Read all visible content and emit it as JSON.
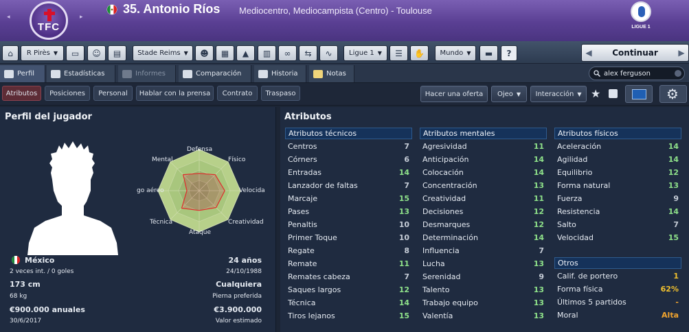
{
  "header": {
    "title": "35. Antonio Ríos",
    "subtitle": "Mediocentro, Mediocampista (Centro) - Toulouse",
    "club_badge": "TFC",
    "league_logo": "LIGUE 1",
    "nav_prev": "◂",
    "nav_next": "▸"
  },
  "toolbar": {
    "manager_label": "R Pirès",
    "club_label": "Stade Reims",
    "league_label": "Ligue 1",
    "world_label": "Mundo",
    "help_label": "?",
    "continue_label": "Continuar"
  },
  "tabs": {
    "perfil": "Perfil",
    "estadisticas": "Estadísticas",
    "informes": "Informes",
    "comparacion": "Comparación",
    "historia": "Historia",
    "notas": "Notas",
    "search_value": "alex ferguson"
  },
  "subtabs": {
    "atributos": "Atributos",
    "posiciones": "Posiciones",
    "personal": "Personal",
    "prensa": "Hablar con la prensa",
    "contrato": "Contrato",
    "traspaso": "Traspaso",
    "oferta": "Hacer una oferta",
    "ojeo": "Ojeo",
    "interaccion": "Interacción"
  },
  "profile": {
    "panel_title": "Perfil del jugador",
    "nationality": "México",
    "caps": "2 veces int. / 0 goles",
    "age": "24 años",
    "dob": "24/10/1988",
    "height": "173 cm",
    "foot_value": "Cualquiera",
    "weight": "68 kg",
    "foot_label": "Pierna preferida",
    "wage": "€900.000 anuales",
    "value": "€3.900.000",
    "contract_end": "30/6/2017",
    "value_label": "Valor estimado"
  },
  "radar": {
    "labels": {
      "defensa": "Defensa",
      "fisico": "Físico",
      "velocidad": "Velocida",
      "creatividad": "Creatividad",
      "ataque": "Ataque",
      "tecnica": "Técnica",
      "juego_aereo": "go aéreo",
      "mental": "Mental"
    },
    "values": [
      0.42,
      0.55,
      0.62,
      0.58,
      0.48,
      0.6,
      0.3,
      0.55
    ]
  },
  "attributes": {
    "panel_title": "Atributos",
    "tecnicos": {
      "title": "Atributos técnicos",
      "items": [
        {
          "name": "Centros",
          "value": "7",
          "tone": "w"
        },
        {
          "name": "Córners",
          "value": "6",
          "tone": "w"
        },
        {
          "name": "Entradas",
          "value": "14",
          "tone": "g"
        },
        {
          "name": "Lanzador de faltas",
          "value": "7",
          "tone": "w"
        },
        {
          "name": "Marcaje",
          "value": "15",
          "tone": "g"
        },
        {
          "name": "Pases",
          "value": "13",
          "tone": "g"
        },
        {
          "name": "Penaltis",
          "value": "10",
          "tone": "w"
        },
        {
          "name": "Primer Toque",
          "value": "10",
          "tone": "w"
        },
        {
          "name": "Regate",
          "value": "8",
          "tone": "w"
        },
        {
          "name": "Remate",
          "value": "11",
          "tone": "g"
        },
        {
          "name": "Remates cabeza",
          "value": "7",
          "tone": "w"
        },
        {
          "name": "Saques largos",
          "value": "12",
          "tone": "g"
        },
        {
          "name": "Técnica",
          "value": "14",
          "tone": "g"
        },
        {
          "name": "Tiros lejanos",
          "value": "15",
          "tone": "g"
        }
      ]
    },
    "mentales": {
      "title": "Atributos mentales",
      "items": [
        {
          "name": "Agresividad",
          "value": "11",
          "tone": "g"
        },
        {
          "name": "Anticipación",
          "value": "14",
          "tone": "g"
        },
        {
          "name": "Colocación",
          "value": "14",
          "tone": "g"
        },
        {
          "name": "Concentración",
          "value": "13",
          "tone": "g"
        },
        {
          "name": "Creatividad",
          "value": "11",
          "tone": "g"
        },
        {
          "name": "Decisiones",
          "value": "12",
          "tone": "g"
        },
        {
          "name": "Desmarques",
          "value": "12",
          "tone": "g"
        },
        {
          "name": "Determinación",
          "value": "14",
          "tone": "g"
        },
        {
          "name": "Influencia",
          "value": "7",
          "tone": "w"
        },
        {
          "name": "Lucha",
          "value": "13",
          "tone": "g"
        },
        {
          "name": "Serenidad",
          "value": "9",
          "tone": "w"
        },
        {
          "name": "Talento",
          "value": "13",
          "tone": "g"
        },
        {
          "name": "Trabajo equipo",
          "value": "13",
          "tone": "g"
        },
        {
          "name": "Valentía",
          "value": "13",
          "tone": "g"
        }
      ]
    },
    "fisicos": {
      "title": "Atributos físicos",
      "items": [
        {
          "name": "Aceleración",
          "value": "14",
          "tone": "g"
        },
        {
          "name": "Agilidad",
          "value": "14",
          "tone": "g"
        },
        {
          "name": "Equilibrio",
          "value": "12",
          "tone": "g"
        },
        {
          "name": "Forma natural",
          "value": "13",
          "tone": "g"
        },
        {
          "name": "Fuerza",
          "value": "9",
          "tone": "w"
        },
        {
          "name": "Resistencia",
          "value": "14",
          "tone": "g"
        },
        {
          "name": "Salto",
          "value": "7",
          "tone": "w"
        },
        {
          "name": "Velocidad",
          "value": "15",
          "tone": "g"
        }
      ]
    },
    "otros": {
      "title": "Otros",
      "items": [
        {
          "name": "Calif. de portero",
          "value": "1",
          "tone": "y"
        },
        {
          "name": "Forma física",
          "value": "62%",
          "tone": "y"
        },
        {
          "name": "Últimos 5 partidos",
          "value": "-",
          "tone": "o"
        },
        {
          "name": "Moral",
          "value": "Alta",
          "tone": "o"
        }
      ]
    }
  },
  "colors": {
    "header": "#5a3f93",
    "panel": "#1f2b40",
    "accent_green": "#8fe28a",
    "accent_yellow": "#f2c12e",
    "heading_blue": "#15325a"
  }
}
